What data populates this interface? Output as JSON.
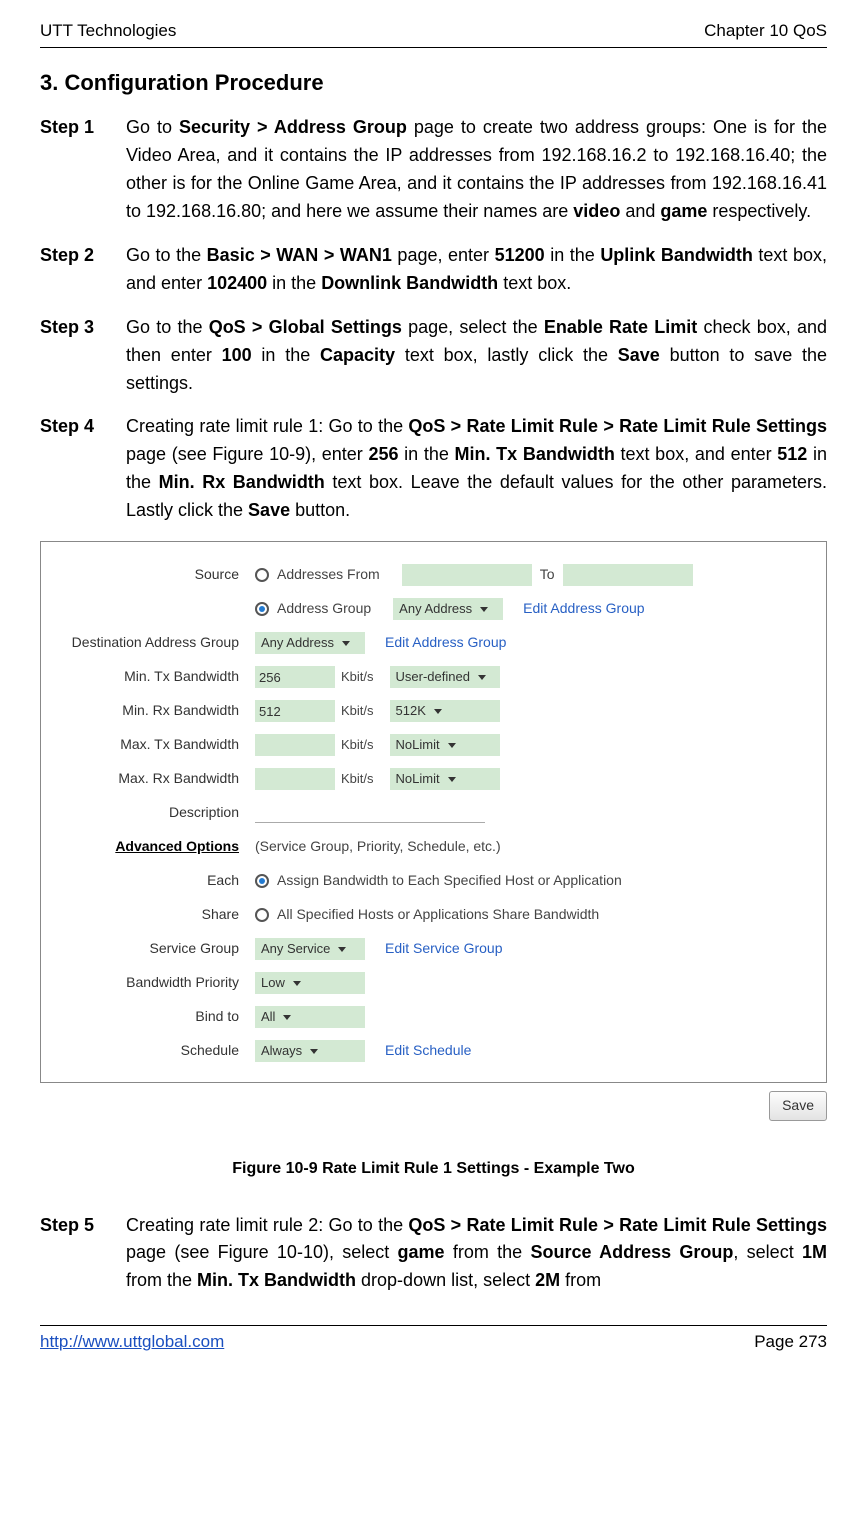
{
  "header": {
    "left": "UTT Technologies",
    "right": "Chapter 10 QoS"
  },
  "title": "3.   Configuration Procedure",
  "steps": {
    "s1": {
      "label": "Step 1",
      "pre1": "Go to ",
      "b1": "Security > Address Group",
      "post1": " page to create two address groups: One is for the Video Area, and it contains the IP addresses from 192.168.16.2 to 192.168.16.40; the other is for the Online Game Area, and it contains the IP addresses from 192.168.16.41 to 192.168.16.80; and here we assume their names are ",
      "b2": "video",
      "mid2": " and ",
      "b3": "game",
      "post2": " respectively."
    },
    "s2": {
      "label": "Step 2",
      "pre1": "Go to the ",
      "b1": "Basic > WAN > WAN1",
      "mid1": " page, enter ",
      "b2": "51200",
      "mid2": " in the ",
      "b3": "Uplink Bandwidth",
      "mid3": " text box, and enter ",
      "b4": "102400",
      "mid4": " in the ",
      "b5": "Downlink Bandwidth",
      "post": " text box."
    },
    "s3": {
      "label": "Step 3",
      "pre1": "Go to the ",
      "b1": "QoS > Global Settings",
      "mid1": " page, select the ",
      "b2": "Enable Rate Limit",
      "mid2": " check box, and then enter ",
      "b3": "100",
      "mid3": " in the ",
      "b4": "Capacity",
      "mid4": " text box, lastly click the ",
      "b5": "Save",
      "post": " button to save the settings."
    },
    "s4": {
      "label": "Step 4",
      "pre1": "Creating rate limit rule 1: Go to the ",
      "b1": "QoS > Rate Limit Rule > Rate Limit Rule Settings",
      "mid1": " page (see Figure 10-9), enter ",
      "b2": "256",
      "mid2": " in the ",
      "b3": "Min. Tx Bandwidth",
      "mid3": " text box, and enter ",
      "b4": "512",
      "mid4": " in the ",
      "b5": "Min. Rx Bandwidth",
      "mid5": " text box. Leave the default values for the other parameters. Lastly click the ",
      "b6": "Save",
      "post": " button."
    },
    "s5": {
      "label": "Step 5",
      "pre1": "Creating rate limit rule 2: Go to the ",
      "b1": "QoS > Rate Limit Rule > Rate Limit Rule Settings",
      "mid1": " page (see Figure 10-10), select ",
      "b2": "game",
      "mid2": " from the ",
      "b3": "Source Address Group",
      "mid3": ", select ",
      "b4": "1M",
      "mid4": " from the ",
      "b5": "Min. Tx Bandwidth",
      "mid5": " drop-down list, select ",
      "b6": "2M",
      "post": " from"
    }
  },
  "form": {
    "labels": {
      "source": "Source",
      "addrFrom": "Addresses From",
      "to": "To",
      "addrGroup": "Address Group",
      "editAddrGroup": "Edit Address Group",
      "destGroup": "Destination Address Group",
      "minTx": "Min. Tx Bandwidth",
      "minRx": "Min. Rx Bandwidth",
      "maxTx": "Max. Tx Bandwidth",
      "maxRx": "Max. Rx Bandwidth",
      "unit": "Kbit/s",
      "desc": "Description",
      "adv": "Advanced Options",
      "advSub": "(Service Group, Priority, Schedule, etc.)",
      "each": "Each",
      "eachTxt": "Assign Bandwidth to Each Specified Host or Application",
      "share": "Share",
      "shareTxt": "All Specified Hosts or Applications Share Bandwidth",
      "svcGroup": "Service Group",
      "editSvcGroup": "Edit Service Group",
      "bwPriority": "Bandwidth Priority",
      "bindTo": "Bind to",
      "schedule": "Schedule",
      "editSchedule": "Edit Schedule"
    },
    "values": {
      "srcGroupSel": "Any Address",
      "destGroupSel": "Any Address",
      "minTx": "256",
      "minTxSel": "User-defined",
      "minRx": "512",
      "minRxSel": "512K",
      "maxTx": "",
      "maxTxSel": "NoLimit",
      "maxRx": "",
      "maxRxSel": "NoLimit",
      "desc": "",
      "svcGroupSel": "Any Service",
      "prioritySel": "Low",
      "bindSel": "All",
      "scheduleSel": "Always"
    },
    "save": "Save"
  },
  "caption": "Figure 10-9 Rate Limit Rule 1 Settings - Example Two",
  "footer": {
    "url": "http://www.uttglobal.com",
    "page": "Page 273"
  }
}
